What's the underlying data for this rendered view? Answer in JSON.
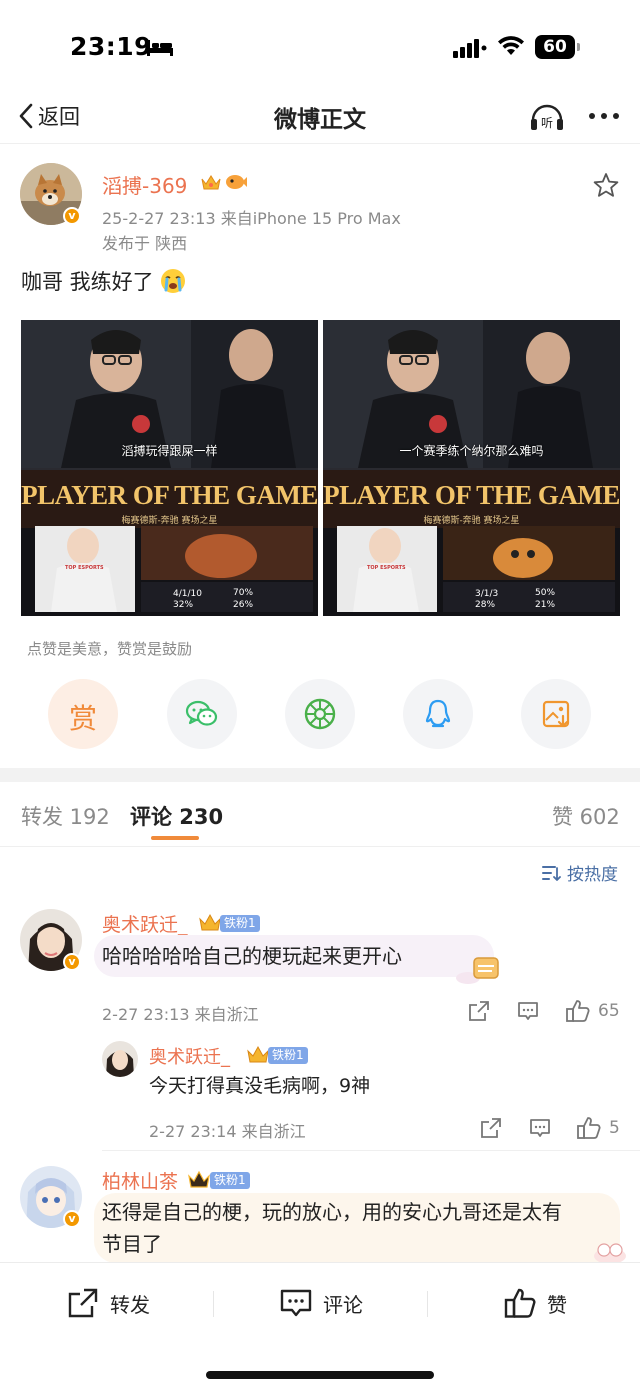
{
  "status_bar": {
    "time": "23:19",
    "battery": "60",
    "icons": [
      "bed-icon",
      "signal-icon",
      "wifi-icon",
      "battery-icon"
    ]
  },
  "nav": {
    "back_label": "返回",
    "title": "微博正文",
    "icons": [
      "chevron-left-icon",
      "listen-icon",
      "more-icon"
    ]
  },
  "post": {
    "author": "滔搏-369",
    "time_source": "25-2-27 23:13  来自iPhone 15 Pro Max",
    "location": "发布于 陕西",
    "text": "咖哥 我练好了",
    "images": [
      {
        "caption": "滔搏玩得跟屎一样",
        "banner": "PLAYER OF THE GAME",
        "sub_banner": "梅赛德斯-奔驰 赛场之星",
        "kda": "4/1/10",
        "stat_1": "70%",
        "stat_2": "32%",
        "stat_3": "26%",
        "team_logo": "TOP ESPORTS"
      },
      {
        "caption": "一个赛季练个纳尔那么难吗",
        "banner": "PLAYER OF THE GAME",
        "sub_banner": "梅赛德斯-奔驰 赛场之星",
        "kda": "3/1/3",
        "stat_1": "50%",
        "stat_2": "28%",
        "stat_3": "21%",
        "team_logo": "TOP ESPORTS"
      }
    ]
  },
  "reward": {
    "tip": "点赞是美意，赞赏是鼓励",
    "reward_label": "赏",
    "share_targets": [
      "wechat-icon",
      "moments-icon",
      "qq-icon",
      "save-image-icon"
    ]
  },
  "tabs": {
    "repost": "转发 192",
    "comment": "评论 230",
    "like": "赞 602",
    "sort": "按热度"
  },
  "comments": [
    {
      "name": "奥术跃迁_",
      "fan_badge": "铁粉1",
      "text": "哈哈哈哈哈自己的梗玩起来更开心",
      "meta": "2-27 23:13  来自浙江",
      "likes": "65"
    },
    {
      "name": "奥术跃迁_",
      "fan_badge": "铁粉1",
      "text": "今天打得真没毛病啊，9神",
      "meta": "2-27 23:14  来自浙江",
      "likes": "5"
    },
    {
      "name": "柏林山茶",
      "fan_badge": "铁粉1",
      "text_line1": "还得是自己的梗，玩的放心，用的安心九哥还是太有",
      "text_line2": "节目了"
    }
  ],
  "bottom_bar": {
    "repost": "转发",
    "comment": "评论",
    "like": "赞"
  },
  "colors": {
    "accent_orange": "#eb7350",
    "tab_underline": "#f08a3a",
    "link_blue": "#4a6fa5",
    "fan_badge_blue": "#7fa6e8",
    "verified_orange": "#f39800"
  }
}
